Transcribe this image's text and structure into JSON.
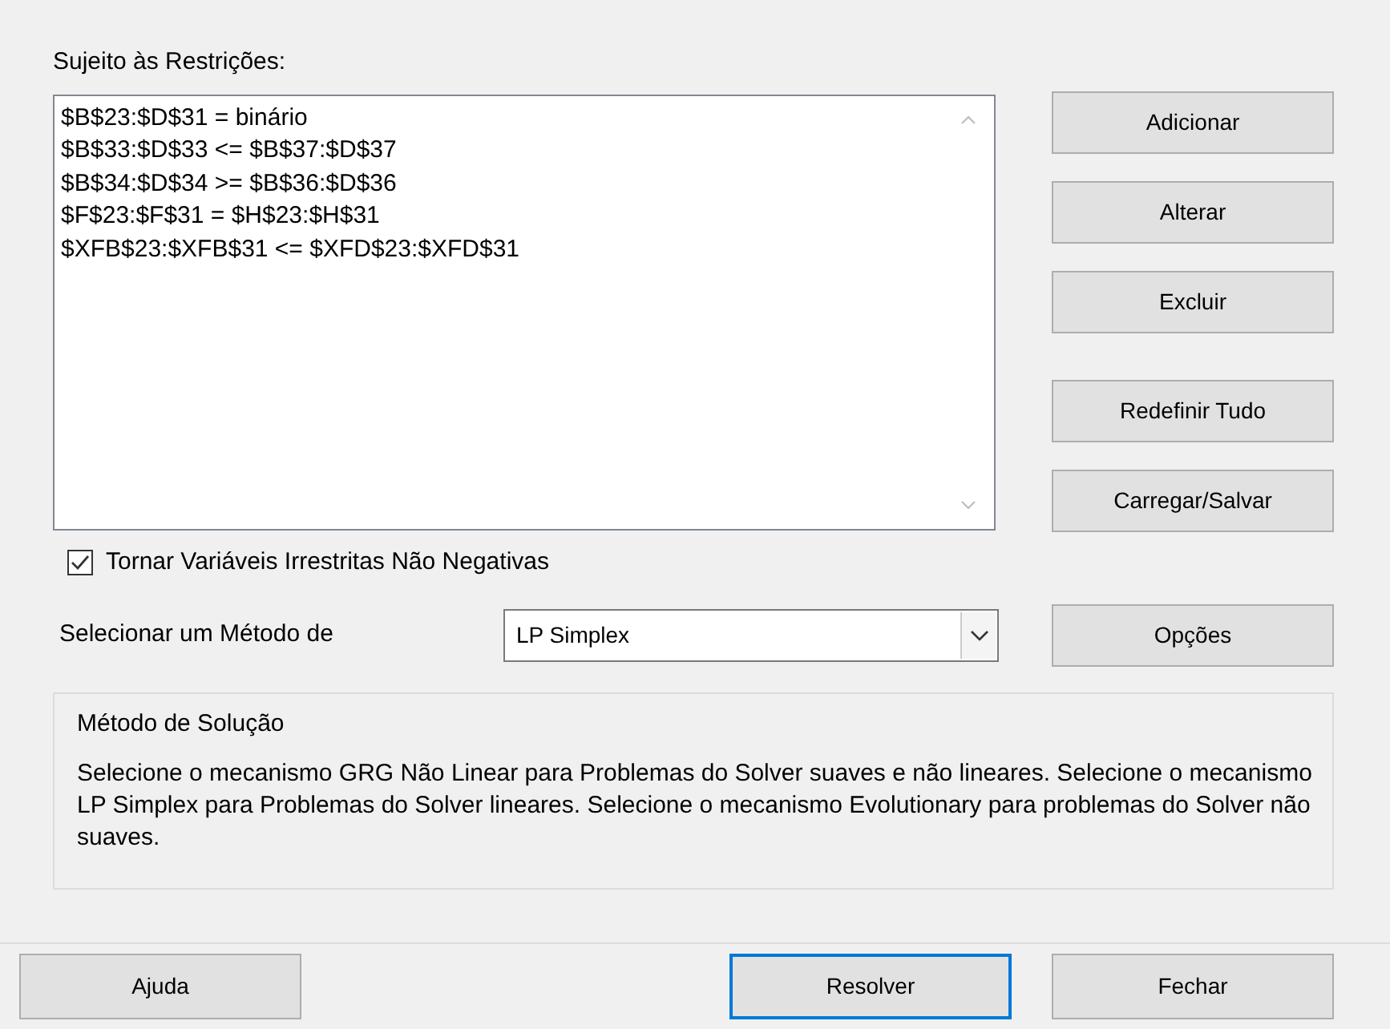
{
  "constraints": {
    "label": "Sujeito às Restrições:",
    "items": [
      "$B$23:$D$31 = binário",
      "$B$33:$D$33 <= $B$37:$D$37",
      "$B$34:$D$34 >= $B$36:$D$36",
      "$F$23:$F$31 = $H$23:$H$31",
      "$XFB$23:$XFB$31 <= $XFD$23:$XFD$31"
    ]
  },
  "side_buttons": [
    {
      "label": "Adicionar"
    },
    {
      "label": "Alterar"
    },
    {
      "label": "Excluir"
    },
    {
      "label": "Redefinir Tudo"
    },
    {
      "label": "Carregar/Salvar"
    }
  ],
  "nonnegative": {
    "label": "Tornar Variáveis Irrestritas Não Negativas",
    "checked": true
  },
  "method": {
    "label": "Selecionar um Método de",
    "value": "LP Simplex"
  },
  "options_button": {
    "label": "Opções"
  },
  "solving_method": {
    "title": "Método de Solução",
    "text": "Selecione o mecanismo GRG Não Linear para Problemas do Solver suaves e não lineares. Selecione o mecanismo LP Simplex para Problemas do Solver lineares. Selecione o mecanismo Evolutionary para problemas do Solver não suaves."
  },
  "footer_buttons": [
    {
      "label": "Ajuda",
      "default": false
    },
    {
      "label": "Resolver",
      "default": true
    },
    {
      "label": "Fechar",
      "default": false
    }
  ]
}
